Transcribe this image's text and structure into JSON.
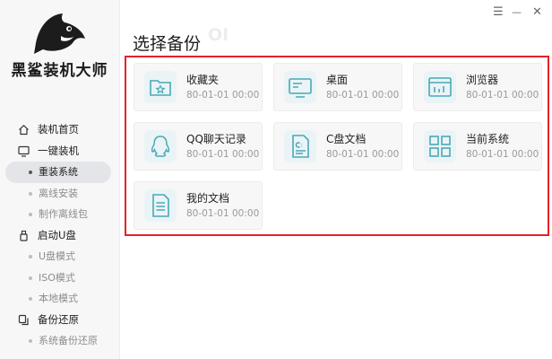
{
  "window": {
    "minimize_label": "—",
    "close_label": "✕",
    "menu_label": "☰"
  },
  "app": {
    "name": "黑鲨装机大师"
  },
  "watermark": "OI",
  "page": {
    "title": "选择备份"
  },
  "sidebar": {
    "sections": [
      {
        "label": "装机首页",
        "icon": "home-icon"
      },
      {
        "label": "一键装机",
        "icon": "monitor-icon",
        "items": [
          {
            "label": "重装系统",
            "active": true
          },
          {
            "label": "离线安装"
          },
          {
            "label": "制作离线包"
          }
        ]
      },
      {
        "label": "启动U盘",
        "icon": "usb-icon",
        "items": [
          {
            "label": "U盘模式"
          },
          {
            "label": "ISO模式"
          },
          {
            "label": "本地模式"
          }
        ]
      },
      {
        "label": "备份还原",
        "icon": "copy-icon",
        "items": [
          {
            "label": "系统备份还原"
          }
        ]
      }
    ]
  },
  "backups": [
    {
      "name": "收藏夹",
      "date": "80-01-01 00:00",
      "icon": "favorites-folder-icon"
    },
    {
      "name": "桌面",
      "date": "80-01-01 00:00",
      "icon": "desktop-icon"
    },
    {
      "name": "浏览器",
      "date": "80-01-01 00:00",
      "icon": "browser-icon"
    },
    {
      "name": "QQ聊天记录",
      "date": "80-01-01 00:00",
      "icon": "qq-icon"
    },
    {
      "name": "C盘文档",
      "date": "80-01-01 00:00",
      "icon": "c-drive-document-icon"
    },
    {
      "name": "当前系统",
      "date": "80-01-01 00:00",
      "icon": "system-grid-icon"
    },
    {
      "name": "我的文档",
      "date": "80-01-01 00:00",
      "icon": "document-icon"
    }
  ],
  "colors": {
    "accent_teal": "#4aa8b5",
    "highlight_border": "#e3222a",
    "icon_bg": "#e9f4f6"
  }
}
